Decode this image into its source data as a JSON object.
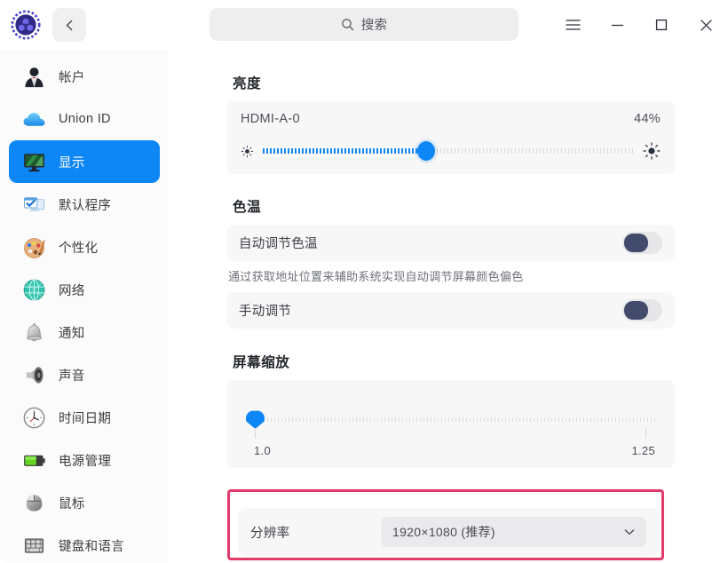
{
  "titlebar": {
    "app_icon": "uos-control-center-logo",
    "back_button": "back-chevron",
    "search_placeholder": "搜索",
    "menu_label": "≡",
    "minimize_label": "—",
    "maximize_label": "□",
    "close_label": "✕"
  },
  "sidebar": {
    "items": [
      {
        "label": "帐户",
        "icon": "account-icon",
        "active": false
      },
      {
        "label": "Union ID",
        "icon": "cloud-icon",
        "active": false
      },
      {
        "label": "显示",
        "icon": "display-monitor-icon",
        "active": true
      },
      {
        "label": "默认程序",
        "icon": "default-apps-icon",
        "active": false
      },
      {
        "label": "个性化",
        "icon": "personalization-icon",
        "active": false
      },
      {
        "label": "网络",
        "icon": "network-globe-icon",
        "active": false
      },
      {
        "label": "通知",
        "icon": "bell-icon",
        "active": false
      },
      {
        "label": "声音",
        "icon": "speaker-icon",
        "active": false
      },
      {
        "label": "时间日期",
        "icon": "clock-icon",
        "active": false
      },
      {
        "label": "电源管理",
        "icon": "battery-icon",
        "active": false
      },
      {
        "label": "鼠标",
        "icon": "mouse-icon",
        "active": false
      },
      {
        "label": "键盘和语言",
        "icon": "keyboard-icon",
        "active": false
      }
    ]
  },
  "main": {
    "brightness": {
      "title": "亮度",
      "monitor_name": "HDMI-A-0",
      "value_label": "44%",
      "value_percent": 44,
      "low_icon": "sun-dim-icon",
      "high_icon": "sun-bright-icon"
    },
    "color_temperature": {
      "title": "色温",
      "auto_adjust_label": "自动调节色温",
      "auto_adjust_on": false,
      "auto_adjust_helper": "通过获取地址位置来辅助系统实现自动调节屏幕颜色偏色",
      "manual_adjust_label": "手动调节",
      "manual_adjust_on": false
    },
    "screen_scaling": {
      "title": "屏幕缩放",
      "min_label": "1.0",
      "max_label": "1.25",
      "value": 1.0,
      "value_percent": 0
    },
    "resolution": {
      "label": "分辨率",
      "selected_value": "1920×1080 (推荐)",
      "chevron_icon": "chevron-down-icon",
      "highlight_color": "#e23a6b"
    }
  },
  "colors": {
    "accent": "#0d87f5",
    "toggle_off_knob": "#424b6b",
    "highlight_border": "#e23a6b",
    "card_bg": "#f7f7f8",
    "sidebar_bg": "#fbfbfb"
  }
}
